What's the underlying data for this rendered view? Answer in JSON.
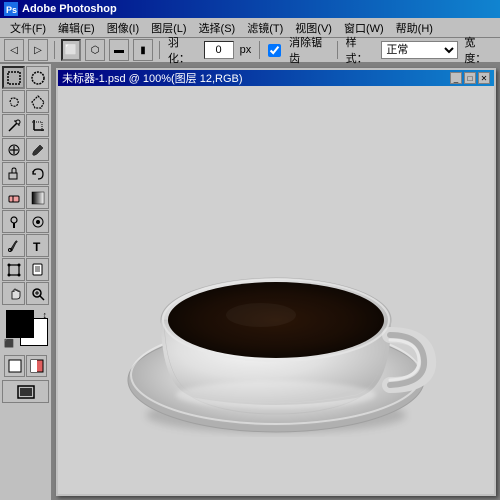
{
  "app": {
    "title": "Adobe Photoshop",
    "title_icon": "PS"
  },
  "menubar": {
    "items": [
      {
        "label": "文件(F)"
      },
      {
        "label": "编辑(E)"
      },
      {
        "label": "图像(I)"
      },
      {
        "label": "图层(L)"
      },
      {
        "label": "选择(S)"
      },
      {
        "label": "滤镜(T)"
      },
      {
        "label": "视图(V)"
      },
      {
        "label": "窗口(W)"
      },
      {
        "label": "帮助(H)"
      }
    ]
  },
  "optionsbar": {
    "feather_label": "羽化：",
    "feather_value": "0",
    "feather_unit": "px",
    "antialias_label": "消除锯齿",
    "style_label": "样式：",
    "style_value": "正常",
    "width_label": "宽度："
  },
  "document": {
    "title": "未标器-1.psd @ 100%(图层 12,RGB)"
  },
  "toolbox": {
    "tools": [
      {
        "row": [
          {
            "icon": "◻",
            "name": "marquee-rect"
          },
          {
            "icon": "◌",
            "name": "marquee-ellipse"
          }
        ]
      },
      {
        "row": [
          {
            "icon": "✂",
            "name": "lasso"
          },
          {
            "icon": "⬡",
            "name": "polygonal-lasso"
          }
        ]
      },
      {
        "row": [
          {
            "icon": "✦",
            "name": "magic-wand"
          },
          {
            "icon": "✂",
            "name": "crop"
          }
        ]
      },
      {
        "row": [
          {
            "icon": "✒",
            "name": "healing"
          },
          {
            "icon": "🖌",
            "name": "brush"
          }
        ]
      },
      {
        "row": [
          {
            "icon": "S",
            "name": "clone-stamp"
          },
          {
            "icon": "◈",
            "name": "history-brush"
          }
        ]
      },
      {
        "row": [
          {
            "icon": "◉",
            "name": "eraser"
          },
          {
            "icon": "▩",
            "name": "gradient"
          }
        ]
      },
      {
        "row": [
          {
            "icon": "△",
            "name": "dodge"
          },
          {
            "icon": "◎",
            "name": "smudge"
          }
        ]
      },
      {
        "row": [
          {
            "icon": "✦",
            "name": "pen"
          },
          {
            "icon": "T",
            "name": "type"
          }
        ]
      },
      {
        "row": [
          {
            "icon": "✧",
            "name": "shape"
          },
          {
            "icon": "⊹",
            "name": "notes"
          }
        ]
      },
      {
        "row": [
          {
            "icon": "☞",
            "name": "direct-select"
          },
          {
            "icon": "🔍",
            "name": "zoom"
          }
        ]
      },
      {
        "colors": true
      },
      {
        "masks": true
      },
      {
        "row": [
          {
            "icon": "▣",
            "name": "quick-mask-off"
          },
          {
            "icon": "▦",
            "name": "quick-mask-on"
          }
        ]
      },
      {
        "row_single": [
          {
            "icon": "⬜",
            "name": "screen-mode"
          }
        ]
      }
    ]
  },
  "colors": {
    "foreground": "#000000",
    "background": "#ffffff"
  }
}
